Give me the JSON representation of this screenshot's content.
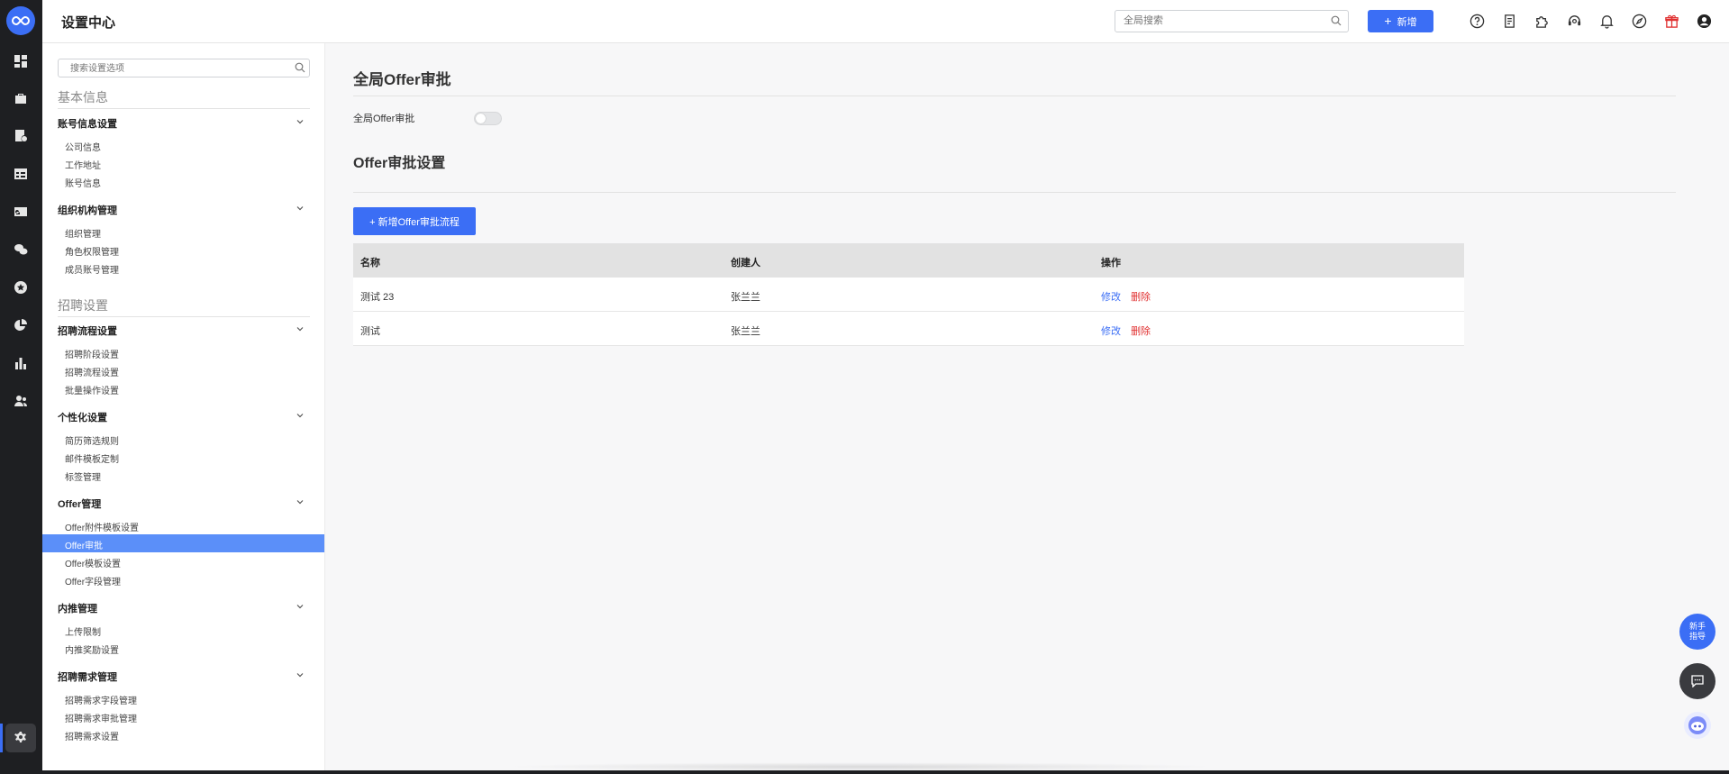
{
  "header": {
    "title": "设置中心",
    "search_placeholder": "全局搜索",
    "new_button_label": "新增",
    "icons": [
      "help-icon",
      "document-icon",
      "plugin-icon",
      "support-icon",
      "bell-icon",
      "compass-icon",
      "gift-icon",
      "user-icon"
    ]
  },
  "rail": {
    "logo_text": "∞",
    "icons": [
      "dashboard-icon",
      "briefcase-icon",
      "resume-icon",
      "calendar-table-icon",
      "id-card-icon",
      "chat-icon",
      "star-icon",
      "pie-chart-icon",
      "bar-chart-icon",
      "team-icon",
      "settings-icon"
    ]
  },
  "panel": {
    "search_placeholder": "搜索设置选项",
    "sections": [
      {
        "title": "基本信息",
        "groups": [
          {
            "label": "账号信息设置",
            "items": [
              "公司信息",
              "工作地址",
              "账号信息"
            ]
          },
          {
            "label": "组织机构管理",
            "items": [
              "组织管理",
              "角色权限管理",
              "成员账号管理"
            ]
          }
        ]
      },
      {
        "title": "招聘设置",
        "groups": [
          {
            "label": "招聘流程设置",
            "items": [
              "招聘阶段设置",
              "招聘流程设置",
              "批量操作设置"
            ]
          },
          {
            "label": "个性化设置",
            "items": [
              "简历筛选规则",
              "邮件模板定制",
              "标签管理"
            ]
          },
          {
            "label": "Offer管理",
            "items": [
              "Offer附件模板设置",
              "Offer审批",
              "Offer模板设置",
              "Offer字段管理"
            ]
          },
          {
            "label": "内推管理",
            "items": [
              "上传限制",
              "内推奖励设置"
            ]
          },
          {
            "label": "招聘需求管理",
            "items": [
              "招聘需求字段管理",
              "招聘需求审批管理",
              "招聘需求设置"
            ]
          }
        ]
      }
    ],
    "active_item": "Offer审批"
  },
  "main": {
    "title": "全局Offer审批",
    "toggle_label": "全局Offer审批",
    "toggle_on": false,
    "subtitle": "Offer审批设置",
    "add_button": "+ 新增Offer审批流程",
    "table": {
      "columns": [
        "名称",
        "创建人",
        "操作"
      ],
      "rows": [
        {
          "name": "测试 23",
          "creator": "张兰兰",
          "edit": "修改",
          "delete": "删除"
        },
        {
          "name": "测试",
          "creator": "张兰兰",
          "edit": "修改",
          "delete": "删除"
        }
      ]
    }
  },
  "floating": {
    "guide_label": "新手指导"
  },
  "colors": {
    "accent": "#3b6ef5",
    "active_item": "#5b8ff9",
    "rail": "#1e1f22",
    "danger": "#e03030"
  }
}
